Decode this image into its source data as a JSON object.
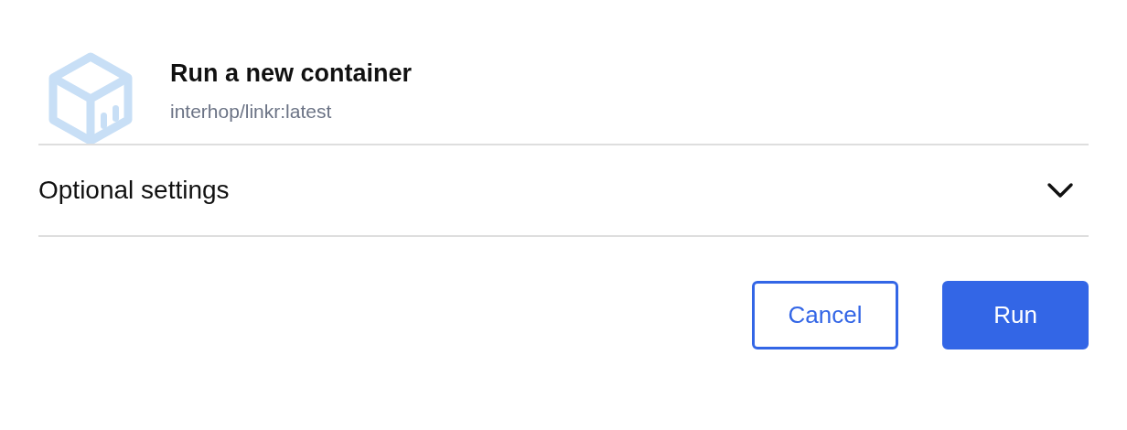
{
  "header": {
    "title": "Run a new container",
    "subtitle": "interhop/linkr:latest"
  },
  "accordion": {
    "label": "Optional settings",
    "expanded": false
  },
  "buttons": [
    {
      "label": "Cancel",
      "kind": "outline"
    },
    {
      "label": "Run",
      "kind": "primary"
    }
  ]
}
